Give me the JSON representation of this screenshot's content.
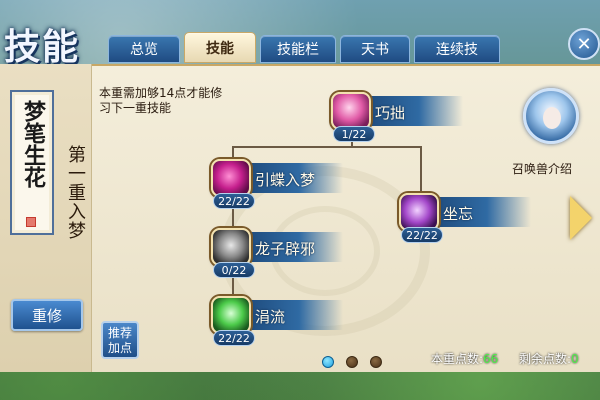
{
  "window": {
    "title": "技能"
  },
  "tabs": [
    {
      "label": "总览",
      "active": false
    },
    {
      "label": "技能",
      "active": true
    },
    {
      "label": "技能栏",
      "active": false
    },
    {
      "label": "天书",
      "active": false
    },
    {
      "label": "连续技",
      "active": false
    }
  ],
  "close_icon": "close-icon",
  "sidebar": {
    "school_calligraphy": "梦笔生花",
    "layer_name": "第一重入梦",
    "reset_label": "重修"
  },
  "requirement_text": "本重需加够14点才能修习下一重技能",
  "skills": [
    {
      "name": "巧拙",
      "level": "1/22",
      "icon": "pink-lotus-icon"
    },
    {
      "name": "引蝶入梦",
      "level": "22/22",
      "icon": "butterfly-icon"
    },
    {
      "name": "龙子辟邪",
      "level": "0/22",
      "icon": "dragon-icon"
    },
    {
      "name": "涓流",
      "level": "22/22",
      "icon": "water-stream-icon"
    },
    {
      "name": "坐忘",
      "level": "22/22",
      "icon": "crystal-meditation-icon"
    }
  ],
  "summon": {
    "label": "召唤兽介绍",
    "icon": "summon-portrait-icon"
  },
  "recommend_label": "推荐加点",
  "pager": {
    "pages": 3,
    "current": 1
  },
  "points": {
    "current_layer_label": "本重点数:",
    "current_layer_value": "66",
    "remaining_label": "剩余点数:",
    "remaining_value": "0"
  },
  "colors": {
    "accent_blue": "#1f4b82",
    "gold": "#f3d36b",
    "points_green": "#4ff04a"
  }
}
